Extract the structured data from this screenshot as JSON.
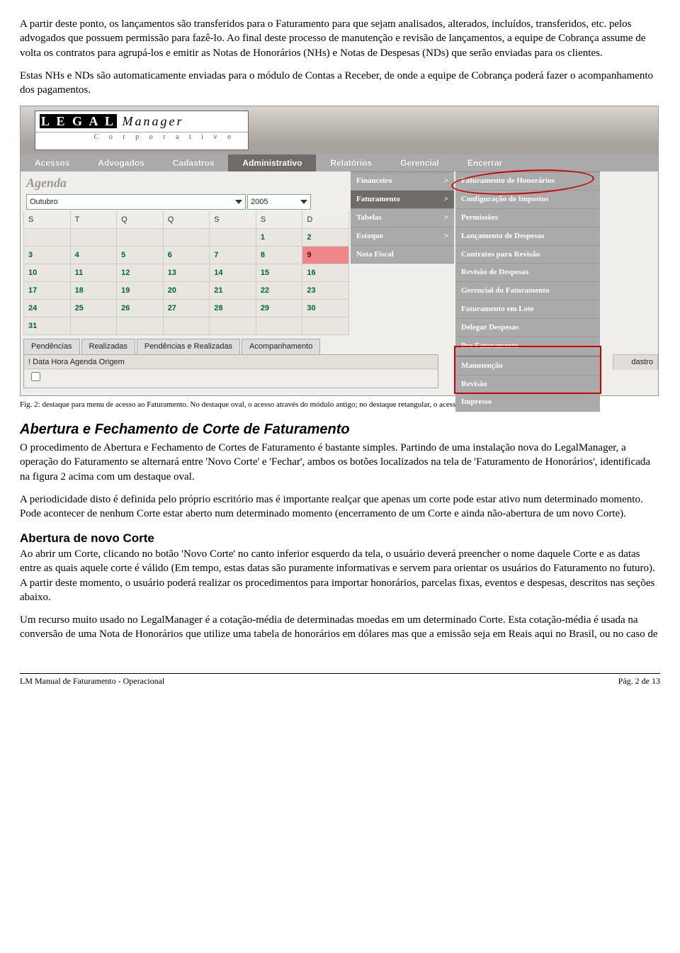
{
  "para1": "A partir deste ponto, os lançamentos são transferidos para o Faturamento para que sejam analisados, alterados, incluídos, transferidos, etc. pelos advogados que possuem permissão para fazê-lo. Ao final deste processo de manutenção e revisão de lançamentos, a equipe de Cobrança assume de volta os contratos para agrupá-los e emitir as Notas de Honorários (NHs) e Notas de Despesas (NDs) que serão enviadas para os clientes.",
  "para2": "Estas NHs e NDs são automaticamente enviadas para o módulo de Contas a Receber, de onde a equipe de Cobrança poderá fazer o acompanhamento dos pagamentos.",
  "screenshot": {
    "logo_main": "L E G A L",
    "logo_mgr": "Manager",
    "logo_sub": "C o r p o r a t i v o",
    "menu": [
      "Acessos",
      "Advogados",
      "Cadastros",
      "Administrativo",
      "Relatórios",
      "Gerencial",
      "Encerrar"
    ],
    "menu_selected_index": 3,
    "agenda_label": "Agenda",
    "month": "Outubro",
    "year": "2005",
    "weekdays": [
      "S",
      "T",
      "Q",
      "Q",
      "S",
      "S",
      "D"
    ],
    "calendar": [
      [
        "",
        "",
        "",
        "",
        "",
        "1",
        "2"
      ],
      [
        "3",
        "4",
        "5",
        "6",
        "7",
        "8",
        "9"
      ],
      [
        "10",
        "11",
        "12",
        "13",
        "14",
        "15",
        "16"
      ],
      [
        "17",
        "18",
        "19",
        "20",
        "21",
        "22",
        "23"
      ],
      [
        "24",
        "25",
        "26",
        "27",
        "28",
        "29",
        "30"
      ],
      [
        "31",
        "",
        "",
        "",
        "",
        "",
        ""
      ]
    ],
    "today_row": 1,
    "today_col": 6,
    "tabs": [
      "Pendências",
      "Realizadas",
      "Pendências e Realizadas",
      "Acompanhamento"
    ],
    "list_header": "!   Data          Hora     Agenda                                                       Origem",
    "dastro": "dastro",
    "submenu1": [
      {
        "label": "Financeiro",
        "arrow": ">"
      },
      {
        "label": "Faturamento",
        "arrow": ">",
        "hl": true
      },
      {
        "label": "Tabelas",
        "arrow": ">"
      },
      {
        "label": "Estoque",
        "arrow": ">"
      },
      {
        "label": "Nota Fiscal",
        "arrow": ""
      }
    ],
    "submenu2": [
      "Faturamento de Honorários",
      "Configuração de Impostos",
      "Permissões",
      "Lançamento de Despesas",
      "Contratos para Revisão",
      "Revisão de Despesas",
      "Gerencial do Faturamento",
      "Faturamento em Lote",
      "Delegar Despesas",
      "Pre Faturamento",
      "Manutenção",
      "Revisão",
      "Impresso"
    ],
    "submenu2_sep_after": 9
  },
  "caption": "Fig. 2: destaque para menu de acesso ao Faturamento. No destaque oval, o acesso através do módulo antigo; no destaque retangular, o acesso às fase através dos módulos novos.",
  "h2_1": "Abertura e Fechamento de Corte de Faturamento",
  "p3": "O procedimento de Abertura e Fechamento de Cortes de Faturamento é bastante simples. Partindo de uma instalação nova do LegalManager, a operação do Faturamento se alternará entre 'Novo Corte' e 'Fechar', ambos os botões localizados na tela de 'Faturamento de Honorários', identificada na figura 2 acima com um destaque oval.",
  "p4": "A periodicidade disto é definida pelo próprio escritório mas é importante realçar que apenas um corte pode estar ativo num determinado momento. Pode acontecer de nenhum Corte estar aberto num determinado momento (encerramento de um Corte e ainda não-abertura de um novo Corte).",
  "h3_1": "Abertura de novo Corte",
  "p5": "Ao abrir um Corte, clicando no botão 'Novo Corte' no canto inferior esquerdo da tela, o usuário deverá preencher o nome daquele Corte e as datas entre as quais aquele corte é válido (Em tempo, estas datas são puramente informativas e servem para orientar os usuários do Faturamento no futuro). A partir deste momento, o usuário poderá realizar os procedimentos para importar honorários, parcelas fixas, eventos e despesas, descritos nas seções abaixo.",
  "p6": "Um recurso muito usado no LegalManager é a cotação-média de determinadas moedas em um determinado Corte. Esta cotação-média é usada na conversão de uma Nota de Honorários que utilize uma tabela de honorários em dólares mas que a emissão seja em Reais aqui no Brasil, ou no caso de",
  "footer_left": "LM Manual de Faturamento - Operacional",
  "footer_right": "Pág. 2 de 13"
}
